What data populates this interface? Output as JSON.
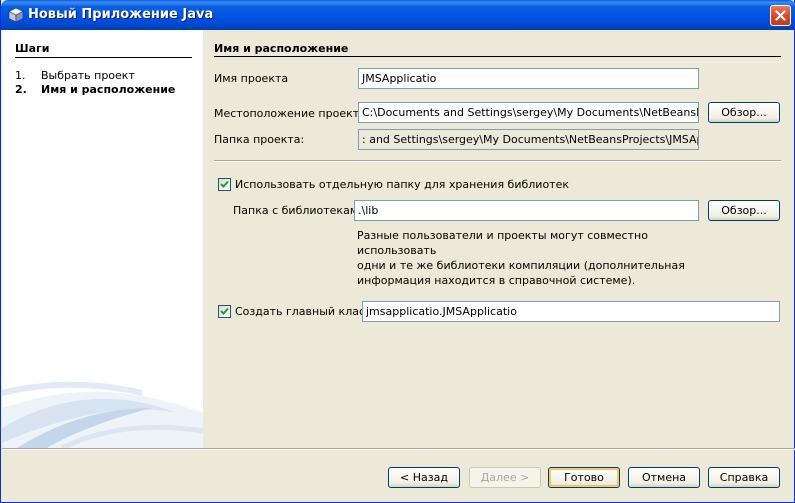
{
  "window": {
    "title": "Новый Приложение Java"
  },
  "steps": {
    "title": "Шаги",
    "items": [
      {
        "num": "1.",
        "label": "Выбрать проект"
      },
      {
        "num": "2.",
        "label": "Имя и расположение"
      }
    ]
  },
  "page": {
    "title": "Имя и расположение",
    "project_name": {
      "label": "Имя проекта",
      "value": "JMSApplicatio"
    },
    "project_location": {
      "label": "Местоположение проекта",
      "value": "C:\\Documents and Settings\\sergey\\My Documents\\NetBeansProjects",
      "browse": "Обзор..."
    },
    "project_folder": {
      "label": "Папка проекта:",
      "value": ": and Settings\\sergey\\My Documents\\NetBeansProjects\\JMSApplicatio"
    },
    "libraries": {
      "checkbox_label": "Использовать отдельную папку для хранения библиотек",
      "checked": true,
      "folder_label": "Папка с библиотеками:",
      "folder_value": ".\\lib",
      "browse": "Обзор...",
      "info_lines": [
        "Разные пользователи и проекты могут совместно использовать",
        "одни и те же библиотеки компиляции (дополнительная",
        "информация находится в справочной системе)."
      ]
    },
    "main_class": {
      "checkbox_label": "Создать главный класс",
      "checked": true,
      "value": "jmsapplicatio.JMSApplicatio"
    }
  },
  "buttons": {
    "back": "< Назад",
    "next": "Далее >",
    "finish": "Готово",
    "cancel": "Отмена",
    "help": "Справка"
  },
  "colors": {
    "titlebar": "#0054e3",
    "panel": "#ece9d8",
    "close": "#d94a2b"
  }
}
